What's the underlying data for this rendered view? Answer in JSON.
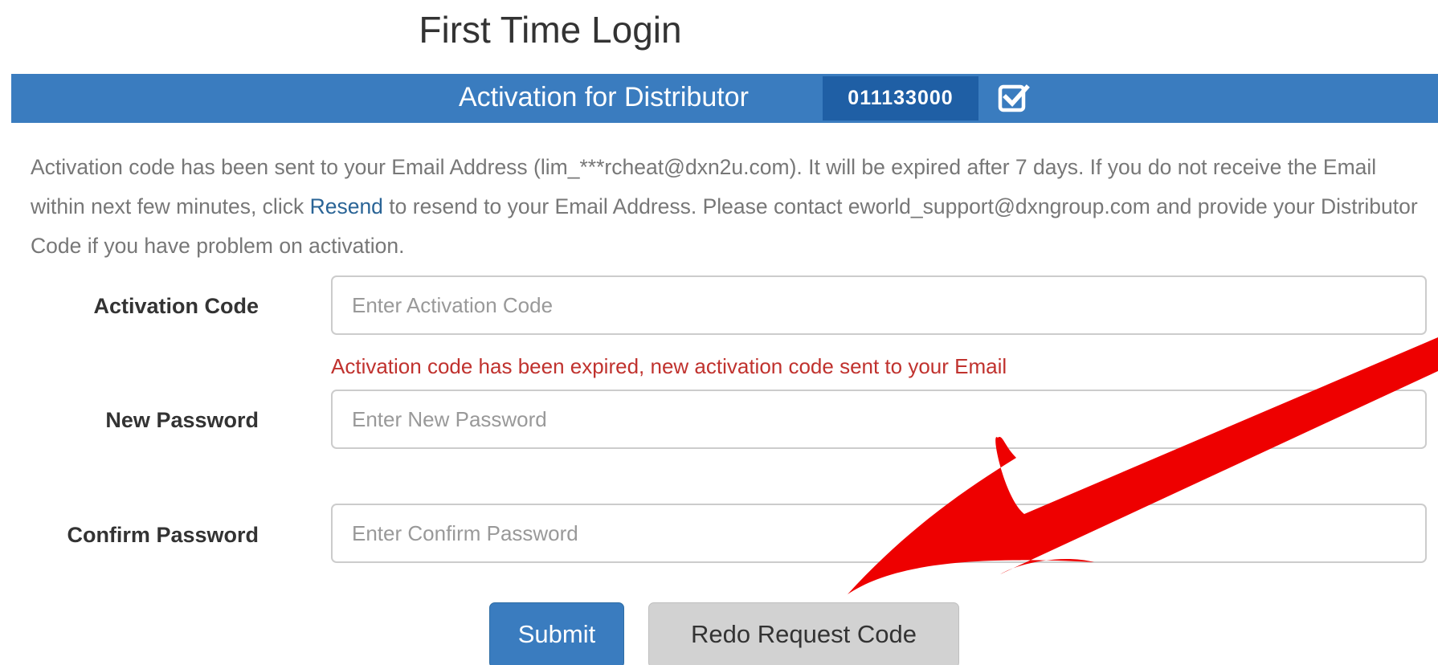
{
  "page": {
    "title": "First Time Login"
  },
  "banner": {
    "label": "Activation for Distributor",
    "distributor_code": "011133000",
    "icon": "check-square-icon"
  },
  "info": {
    "text_before_link": "Activation code has been sent to your Email Address (lim_***rcheat@dxn2u.com). It will be expired after 7 days. If you do not receive the Email within next few minutes, click ",
    "link_text": "Resend",
    "text_after_link": " to resend to your Email Address. Please contact eworld_support@dxngroup.com and provide your Distributor Code if you have problem on activation."
  },
  "form": {
    "activation_code": {
      "label": "Activation Code",
      "placeholder": "Enter Activation Code",
      "value": "",
      "error": "Activation code has been expired, new activation code sent to your Email"
    },
    "new_password": {
      "label": "New Password",
      "placeholder": "Enter New Password",
      "value": ""
    },
    "confirm_password": {
      "label": "Confirm Password",
      "placeholder": "Enter Confirm Password",
      "value": ""
    }
  },
  "buttons": {
    "submit_label": "Submit",
    "redo_label": "Redo Request Code"
  },
  "colors": {
    "primary": "#3a7cbf",
    "badge": "#1f5fa5",
    "error": "#c0322e",
    "link": "#2a6496",
    "annotation_arrow": "#ee0000"
  }
}
